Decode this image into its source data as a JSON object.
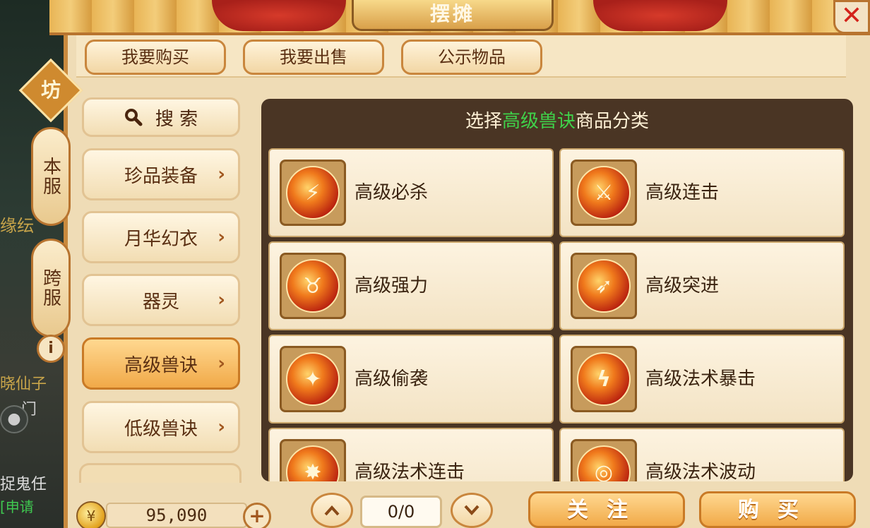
{
  "window": {
    "title": "摆摊",
    "close_label": "✕"
  },
  "top_tabs": [
    {
      "label": "我要购买"
    },
    {
      "label": "我要出售"
    },
    {
      "label": "公示物品"
    }
  ],
  "side_tabs": {
    "badge": "坊",
    "server_local": "本服",
    "server_cross": "跨服",
    "info": "i"
  },
  "sidebar": {
    "search_label": "搜 索",
    "categories": [
      {
        "label": "珍品装备",
        "active": false
      },
      {
        "label": "月华幻衣",
        "active": false
      },
      {
        "label": "器灵",
        "active": false
      },
      {
        "label": "高级兽诀",
        "active": true
      },
      {
        "label": "低级兽诀",
        "active": false
      }
    ]
  },
  "content": {
    "header_prefix": "选择",
    "header_highlight": "高级兽诀",
    "header_suffix": "商品分类",
    "items": [
      {
        "label": "高级必杀",
        "icon": "critical-strike-icon"
      },
      {
        "label": "高级连击",
        "icon": "combo-attack-icon"
      },
      {
        "label": "高级强力",
        "icon": "bull-strength-icon"
      },
      {
        "label": "高级突进",
        "icon": "charge-slash-icon"
      },
      {
        "label": "高级偷袭",
        "icon": "sneak-attack-icon"
      },
      {
        "label": "高级法术暴击",
        "icon": "spell-crit-icon"
      },
      {
        "label": "高级法术连击",
        "icon": "spell-combo-icon"
      },
      {
        "label": "高级法术波动",
        "icon": "spell-wave-icon"
      }
    ]
  },
  "footer": {
    "money": "95,090",
    "add_label": "+",
    "page_up": "⌃",
    "page_down": "⌄",
    "page_value": "0/0",
    "follow_label": "关注",
    "buy_label": "购买"
  },
  "world": {
    "left_text_1": "缘纭",
    "left_text_2": "晓仙子",
    "left_text_3": "门",
    "left_text_4": "捉鬼任",
    "left_text_5": "[申请"
  },
  "colors": {
    "accent": "#f1a948",
    "highlight_green": "#3fd24a",
    "close_red": "#d3221a"
  }
}
